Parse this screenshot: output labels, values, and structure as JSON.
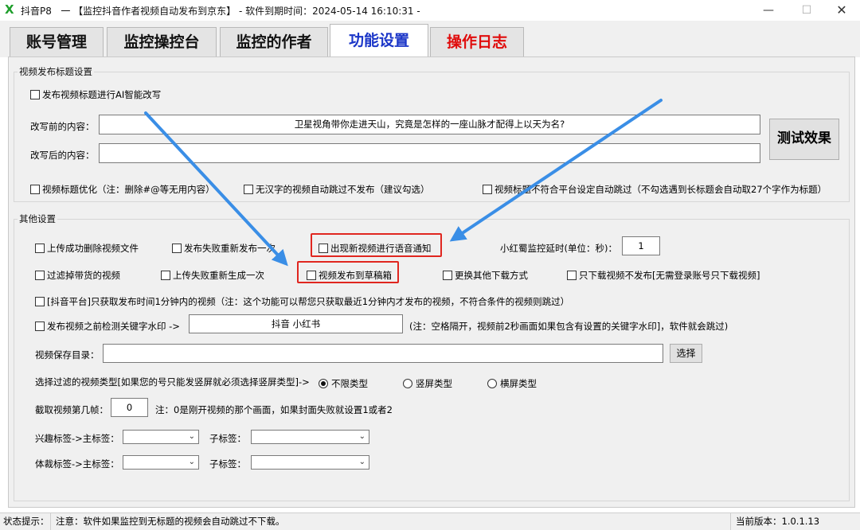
{
  "window": {
    "app_name": "抖音P8",
    "title": "一 【监控抖音作者视频自动发布到京东】 - 软件到期时间：2024-05-14 16:10:31 -",
    "minimize": "—",
    "maximize": "☐",
    "close": "✕"
  },
  "tabs": [
    {
      "label": "账号管理"
    },
    {
      "label": "监控操控台"
    },
    {
      "label": "监控的作者"
    },
    {
      "label": "功能设置",
      "active": true
    },
    {
      "label": "操作日志"
    }
  ],
  "title_group": {
    "heading": "视频发布标题设置",
    "ai_rewrite": "发布视频标题进行AI智能改写",
    "before_label": "改写前的内容：",
    "before_value": "卫星视角带你走进天山，究竟是怎样的一座山脉才配得上以天为名?",
    "after_label": "改写后的内容：",
    "after_value": "",
    "test_button": "测试效果",
    "opt_optimize": "视频标题优化（注：删除#@等无用内容）",
    "opt_no_chinese": "无汉字的视频自动跳过不发布（建议勾选）",
    "opt_title_skip": "视频标题不符合平台设定自动跳过（不勾选遇到长标题会自动取27个字作为标题）"
  },
  "other_group": {
    "heading": "其他设置",
    "row1": {
      "delete_after_upload": "上传成功删除视频文件",
      "republish_on_fail": "发布失败重新发布一次",
      "voice_notify": "出现新视频进行语音通知",
      "xhs_delay_label": "小红蜀监控延时(单位：秒)：",
      "xhs_delay_value": "1"
    },
    "row2": {
      "filter_goods": "过滤掉带货的视频",
      "regenerate_on_fail": "上传失败重新生成一次",
      "publish_to_draft": "视频发布到草稿箱",
      "change_download": "更换其他下载方式",
      "download_only": "只下载视频不发布[无需登录账号只下载视频]"
    },
    "row3": "[抖音平台]只获取发布时间1分钟内的视频（注：这个功能可以帮您只获取最近1分钟内才发布的视频，不符合条件的视频则跳过）",
    "row4": {
      "check_watermark": "发布视频之前检测关键字水印 ->",
      "keywords": "抖音 小红书",
      "note": "(注：空格隔开，视频前2秒画面如果包含有设置的关键字水印]，软件就会跳过)"
    },
    "save_dir": {
      "label": "视频保存目录：",
      "value": "",
      "browse": "选择"
    },
    "video_type": {
      "label": "选择过滤的视频类型[如果您的号只能发竖屏就必须选择竖屏类型]->",
      "options": [
        "不限类型",
        "竖屏类型",
        "横屏类型"
      ],
      "selected": "不限类型"
    },
    "frame": {
      "label": "截取视频第几帧：",
      "value": "0",
      "note": "注：0是刚开视频的那个画面，如果封面失败就设置1或者2"
    },
    "interest_tag": {
      "main_label": "兴趣标签->主标签：",
      "main_value": "",
      "sub_label": "子标签：",
      "sub_value": ""
    },
    "genre_tag": {
      "main_label": "体裁标签->主标签：",
      "main_value": "",
      "sub_label": "子标签：",
      "sub_value": ""
    }
  },
  "status": {
    "label": "状态提示：",
    "message": "注意：软件如果监控到无标题的视频会自动跳过不下载。",
    "version": "当前版本：1.0.1.13"
  },
  "colors": {
    "tab_active": "#1b36c8",
    "tab_log": "#e00c0c",
    "highlight": "#e0261f",
    "arrow": "#3a8ee6"
  },
  "icons": {
    "app_logo": "x-logo-icon",
    "dropdown": "chevron-down-icon"
  }
}
